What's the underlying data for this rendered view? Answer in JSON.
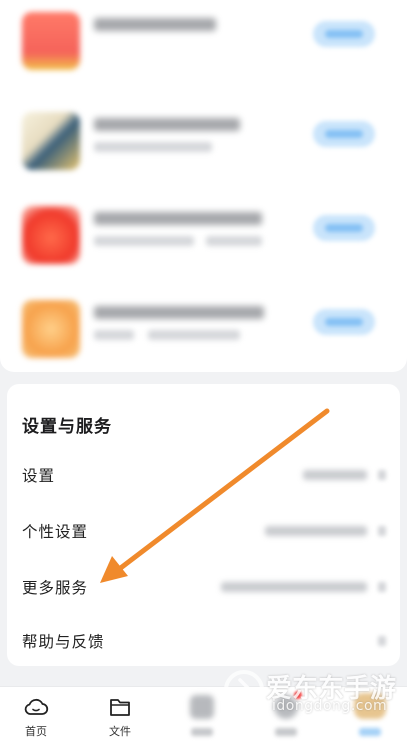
{
  "settings_section": {
    "title": "设置与服务",
    "rows": [
      {
        "label": "设置"
      },
      {
        "label": "个性设置"
      },
      {
        "label": "更多服务"
      },
      {
        "label": "帮助与反馈"
      }
    ]
  },
  "bottom_nav": {
    "items": [
      {
        "label": "首页",
        "icon": "cloud-icon"
      },
      {
        "label": "文件",
        "icon": "folder-icon"
      }
    ]
  },
  "annotation": {
    "color": "#f08a2c",
    "points_to": "更多服务"
  },
  "watermark": {
    "text": "爱东东手游",
    "domain": "idongdong.com"
  },
  "colors": {
    "accent_blue": "#4aa3ee",
    "background": "#f1f2f4",
    "card": "#ffffff"
  }
}
